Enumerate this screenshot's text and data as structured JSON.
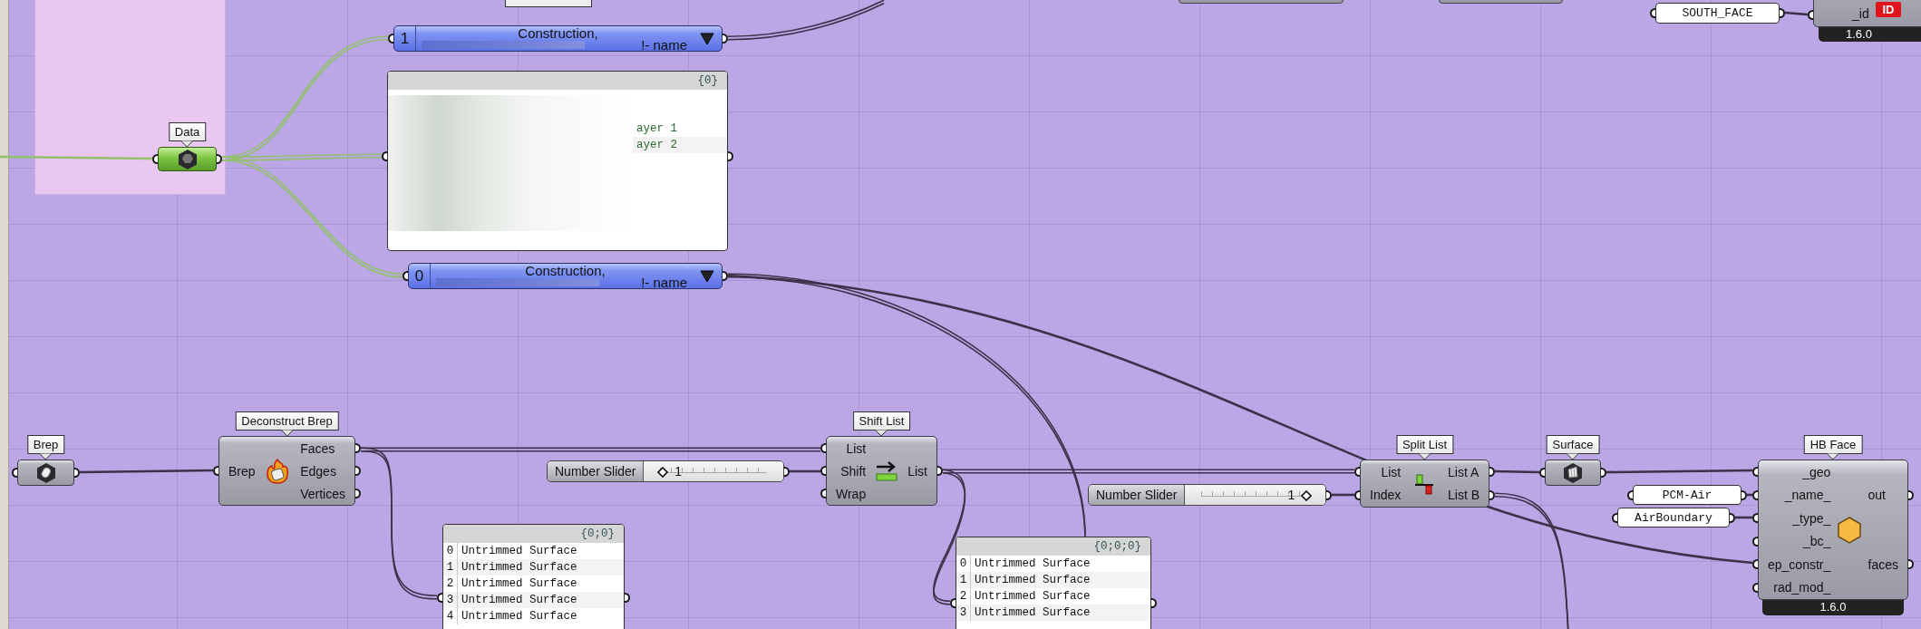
{
  "objects": [
    {
      "kind": "valuelist",
      "selected": false,
      "index": "1",
      "line_1": "Construction,",
      "line_2": "!- name"
    },
    {
      "kind": "param",
      "tag": "Data",
      "selected": true
    },
    {
      "kind": "panel",
      "selected": false,
      "header": "{0}",
      "rows": [
        {
          "text": "ayer 1"
        },
        {
          "text": "ayer 2"
        }
      ]
    },
    {
      "kind": "valuelist",
      "selected": false,
      "index": "0",
      "line_1": "Construction,",
      "line_2": "!- name"
    },
    {
      "kind": "textpanel",
      "selected": false,
      "text": "SOUTH_FACE"
    },
    {
      "kind": "hbpartial",
      "selected": false,
      "inputs": [
        "_id"
      ],
      "badge": "ID",
      "version": "1.6.0"
    },
    {
      "kind": "param",
      "tag": "Brep",
      "selected": false
    },
    {
      "kind": "component",
      "tag": "Deconstruct Brep",
      "selected": false,
      "inputs": [
        "Brep"
      ],
      "outputs": [
        "Faces",
        "Edges",
        "Vertices"
      ]
    },
    {
      "kind": "panel",
      "selected": false,
      "header": "{0;0}",
      "rows": [
        {
          "index": "0",
          "text": "Untrimmed Surface"
        },
        {
          "index": "1",
          "text": "Untrimmed Surface"
        },
        {
          "index": "2",
          "text": "Untrimmed Surface"
        },
        {
          "index": "3",
          "text": "Untrimmed Surface"
        },
        {
          "index": "4",
          "text": "Untrimmed Surface"
        }
      ]
    },
    {
      "kind": "slider",
      "selected": false,
      "name": "Number Slider",
      "value": "1",
      "level": 0.08
    },
    {
      "kind": "component",
      "tag": "Shift List",
      "selected": false,
      "inputs": [
        "List",
        "Shift",
        "Wrap"
      ],
      "outputs": [
        "List"
      ]
    },
    {
      "kind": "panel",
      "selected": false,
      "header": "{0;0;0}",
      "rows": [
        {
          "index": "0",
          "text": "Untrimmed Surface"
        },
        {
          "index": "1",
          "text": "Untrimmed Surface"
        },
        {
          "index": "2",
          "text": "Untrimmed Surface"
        },
        {
          "index": "3",
          "text": "Untrimmed Surface"
        }
      ]
    },
    {
      "kind": "slider",
      "selected": false,
      "name": "Number Slider",
      "value": "1",
      "level": 0.92
    },
    {
      "kind": "component",
      "tag": "Split List",
      "selected": false,
      "inputs": [
        "List",
        "Index"
      ],
      "outputs": [
        "List A",
        "List B"
      ]
    },
    {
      "kind": "param",
      "tag": "Surface",
      "selected": false
    },
    {
      "kind": "textpanel",
      "selected": false,
      "text": "PCM-Air"
    },
    {
      "kind": "textpanel",
      "selected": false,
      "text": "AirBoundary"
    },
    {
      "kind": "component",
      "tag": "HB Face",
      "selected": false,
      "inputs": [
        "_geo",
        "_name_",
        "_type_",
        "_bc_",
        "ep_constr_",
        "rad_mod_"
      ],
      "outputs": [
        "out",
        "faces"
      ],
      "version": "1.6.0"
    }
  ]
}
